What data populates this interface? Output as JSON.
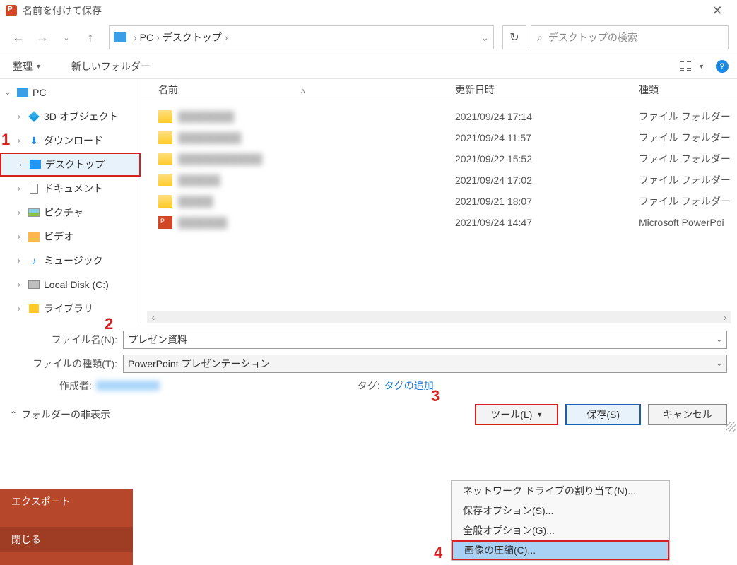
{
  "titlebar": {
    "title": "名前を付けて保存"
  },
  "nav": {
    "address": {
      "root": "PC",
      "folder": "デスクトップ"
    },
    "search_placeholder": "デスクトップの検索"
  },
  "toolbar": {
    "organize": "整理",
    "new_folder": "新しいフォルダー"
  },
  "sidebar": {
    "items": [
      {
        "label": "PC",
        "expanded": true
      },
      {
        "label": "3D オブジェクト"
      },
      {
        "label": "ダウンロード"
      },
      {
        "label": "デスクトップ",
        "selected": true
      },
      {
        "label": "ドキュメント"
      },
      {
        "label": "ピクチャ"
      },
      {
        "label": "ビデオ"
      },
      {
        "label": "ミュージック"
      },
      {
        "label": "Local Disk (C:)"
      },
      {
        "label": "ライブラリ"
      }
    ]
  },
  "columns": {
    "name": "名前",
    "date": "更新日時",
    "type": "種類"
  },
  "files": [
    {
      "date": "2021/09/24 17:14",
      "type": "ファイル フォルダー",
      "icon": "folder"
    },
    {
      "date": "2021/09/24 11:57",
      "type": "ファイル フォルダー",
      "icon": "folder"
    },
    {
      "date": "2021/09/22 15:52",
      "type": "ファイル フォルダー",
      "icon": "folder"
    },
    {
      "date": "2021/09/24 17:02",
      "type": "ファイル フォルダー",
      "icon": "folder"
    },
    {
      "date": "2021/09/21 18:07",
      "type": "ファイル フォルダー",
      "icon": "folder"
    },
    {
      "date": "2021/09/24 14:47",
      "type": "Microsoft PowerPoi",
      "icon": "ppt"
    }
  ],
  "fields": {
    "filename_label": "ファイル名(N):",
    "filename_value": "プレゼン資料",
    "filetype_label": "ファイルの種類(T):",
    "filetype_value": "PowerPoint プレゼンテーション",
    "author_label": "作成者:",
    "tags_label": "タグ:",
    "tags_add": "タグの追加"
  },
  "bottom": {
    "hide_folders": "フォルダーの非表示",
    "tools": "ツール(L)",
    "save": "保存(S)",
    "cancel": "キャンセル"
  },
  "dropdown": {
    "items": [
      "ネットワーク ドライブの割り当て(N)...",
      "保存オプション(S)...",
      "全般オプション(G)...",
      "画像の圧縮(C)..."
    ]
  },
  "backstage": {
    "export": "エクスポート",
    "close": "閉じる"
  },
  "annotations": {
    "n1": "1",
    "n2": "2",
    "n3": "3",
    "n4": "4"
  }
}
